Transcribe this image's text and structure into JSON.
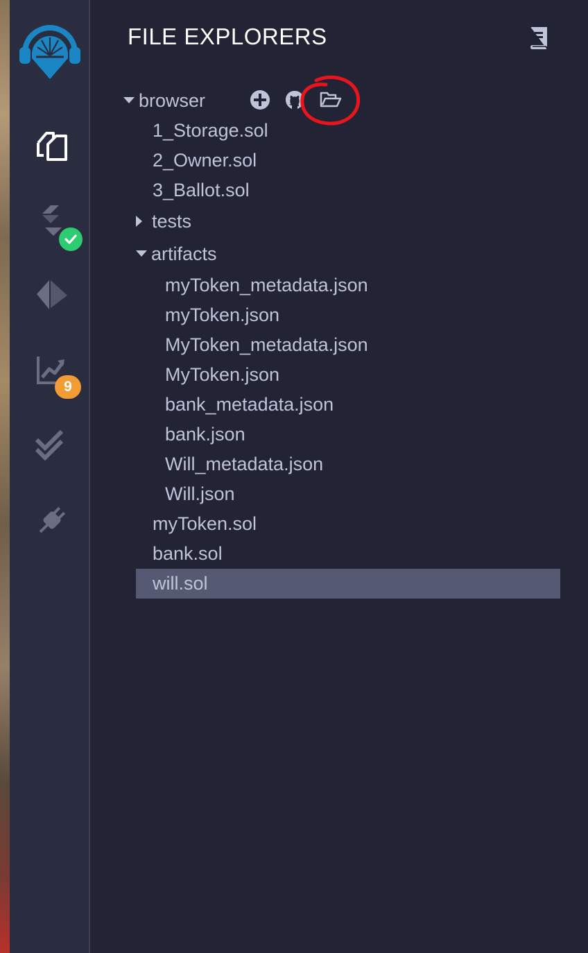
{
  "explorer": {
    "title": "FILE EXPLORERS",
    "workspace": "browser",
    "files_top": [
      "1_Storage.sol",
      "2_Owner.sol",
      "3_Ballot.sol"
    ],
    "folders": {
      "tests": "tests",
      "artifacts": "artifacts"
    },
    "artifact_files": [
      "myToken_metadata.json",
      "myToken.json",
      "MyToken_metadata.json",
      "MyToken.json",
      "bank_metadata.json",
      "bank.json",
      "Will_metadata.json",
      "Will.json"
    ],
    "files_bottom": [
      "myToken.sol",
      "bank.sol",
      "will.sol"
    ],
    "selected_file": "will.sol"
  },
  "sidebar": {
    "icons": [
      "remix-logo-icon",
      "file-explorer-icon",
      "solidity-compiler-icon",
      "deploy-run-icon",
      "analysis-icon",
      "test-icon",
      "plugin-manager-icon"
    ],
    "compiler_status": "success",
    "analysis_badge": "9"
  },
  "colors": {
    "background": "#222335",
    "panel": "#2a2c3f",
    "text": "#c0c4d8",
    "selected": "#555a72",
    "success": "#2ecc71",
    "warning": "#f39c33",
    "annotation": "#e8161c"
  }
}
